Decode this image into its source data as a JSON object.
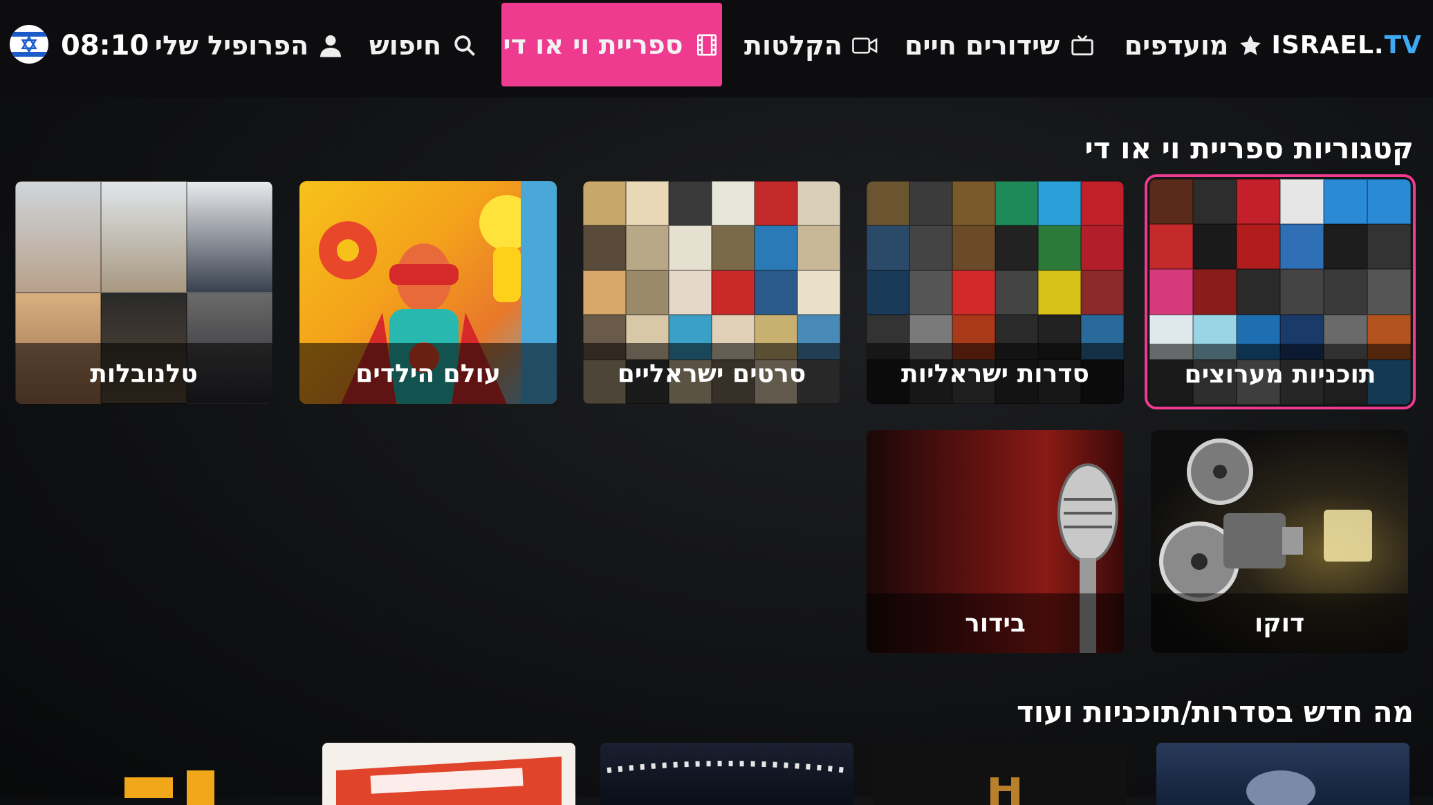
{
  "header": {
    "brand_main": "ISRAEL.",
    "brand_tv": "TV",
    "clock": "08:10",
    "nav": {
      "favorites": "מועדפים",
      "live": "שידורים חיים",
      "recordings": "הקלטות",
      "vod": "ספריית וי או די",
      "search": "חיפוש",
      "profile": "הפרופיל שלי"
    },
    "active_tab": "vod"
  },
  "categories": {
    "title": "קטגוריות ספריית וי או די",
    "tiles": {
      "featured": "תוכניות מערוצים",
      "series": "סדרות ישראליות",
      "movies": "סרטים ישראליים",
      "kids": "עולם הילדים",
      "telenovelas": "טלנובלות",
      "doco": "דוקו",
      "entertainment": "בידור"
    },
    "selected": "featured"
  },
  "whats_new": {
    "title": "מה חדש בסדרות/תוכניות ועוד"
  },
  "colors": {
    "accent": "#ee3a8f",
    "brand_tv": "#3fa9f5",
    "topbar": "#0d0d0f"
  }
}
